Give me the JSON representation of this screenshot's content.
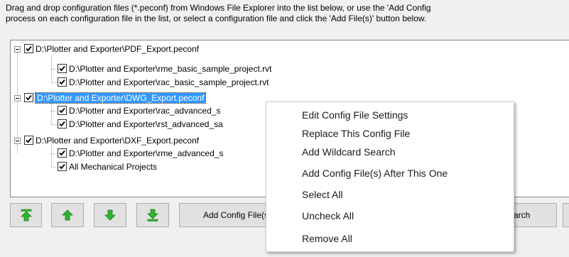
{
  "description": {
    "line1": "Drag and drop configuration files (*.peconf) from Windows File Explorer into the list below, or use the 'Add Config",
    "line2": "process on each configuration file in the list, or select a configuration file and click the 'Add File(s)' button below."
  },
  "tree": {
    "groups": [
      {
        "label": "D:\\Plotter and Exporter\\PDF_Export.peconf",
        "checked": true,
        "selected": false,
        "children": [
          {
            "label": "D:\\Plotter  and  Exporter\\rme_basic_sample_project.rvt",
            "checked": true
          },
          {
            "label": "D:\\Plotter  and  Exporter\\rac_basic_sample_project.rvt",
            "checked": true
          }
        ]
      },
      {
        "label": "D:\\Plotter and Exporter\\DWG_Export.peconf",
        "checked": true,
        "selected": true,
        "children": [
          {
            "label": "D:\\Plotter  and  Exporter\\rac_advanced_s",
            "checked": true
          },
          {
            "label": "D:\\Plotter  and  Exporter\\rst_advanced_sa",
            "checked": true
          }
        ]
      },
      {
        "label": "D:\\Plotter and Exporter\\DXF_Export.peconf",
        "checked": true,
        "selected": false,
        "children": [
          {
            "label": "D:\\Plotter  and  Exporter\\rme_advanced_s",
            "checked": true
          },
          {
            "label": "All Mechanical Projects",
            "checked": true
          }
        ]
      }
    ]
  },
  "buttons": {
    "add_config": "Add Config File(s",
    "search_partial": "arch",
    "move_top_icon": "arrow-top-icon",
    "move_up_icon": "arrow-up-icon",
    "move_down_icon": "arrow-down-icon",
    "move_bottom_icon": "arrow-bottom-icon"
  },
  "context_menu": {
    "items": [
      "Edit Config File Settings",
      "Replace This Config File",
      "Add Wildcard Search",
      "Add Config File(s) After This One",
      "Select All",
      "Uncheck All",
      "Remove All"
    ]
  },
  "colors": {
    "selection": "#3399ff",
    "arrow_green": "#2fb52f"
  }
}
